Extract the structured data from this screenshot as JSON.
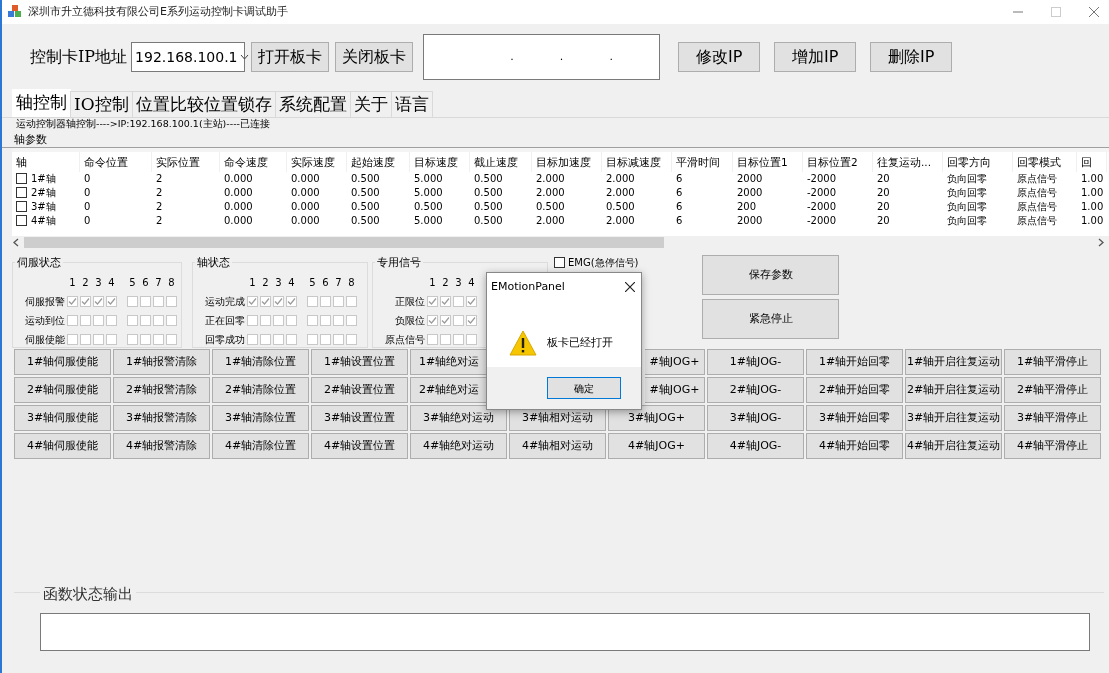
{
  "window": {
    "title": "深圳市升立德科技有限公司E系列运动控制卡调试助手"
  },
  "connection": {
    "label": "控制卡IP地址",
    "ip_value": "192.168.100.1",
    "buttons": [
      "打开板卡",
      "关闭板卡"
    ],
    "ip_separators": [
      ".",
      ".",
      "."
    ],
    "ip_buttons": [
      "修改IP",
      "增加IP",
      "删除IP"
    ]
  },
  "tabs": [
    {
      "label": "轴控制",
      "selected": true
    },
    {
      "label": "IO控制",
      "selected": false
    },
    {
      "label": "位置比较位置锁存",
      "selected": false
    },
    {
      "label": "系统配置",
      "selected": false
    },
    {
      "label": "关于",
      "selected": false
    },
    {
      "label": "语言",
      "selected": false
    }
  ],
  "status_text": "运动控制器轴控制---->IP:192.168.100.1(主站)----已连接",
  "axis_params": {
    "title": "轴参数",
    "columns": [
      "轴",
      "命令位置",
      "实际位置",
      "命令速度",
      "实际速度",
      "起始速度",
      "目标速度",
      "截止速度",
      "目标加速度",
      "目标减速度",
      "平滑时间",
      "目标位置1",
      "目标位置2",
      "往复运动...",
      "回零方向",
      "回零模式",
      "回"
    ],
    "rows": [
      {
        "checked": false,
        "cells": [
          "1#轴",
          "0",
          "2",
          "0.000",
          "0.000",
          "0.500",
          "5.000",
          "0.500",
          "2.000",
          "2.000",
          "6",
          "2000",
          "-2000",
          "20",
          "负向回零",
          "原点信号",
          "1.00"
        ]
      },
      {
        "checked": false,
        "cells": [
          "2#轴",
          "0",
          "2",
          "0.000",
          "0.000",
          "0.500",
          "5.000",
          "0.500",
          "2.000",
          "2.000",
          "6",
          "2000",
          "-2000",
          "20",
          "负向回零",
          "原点信号",
          "1.00"
        ]
      },
      {
        "checked": false,
        "cells": [
          "3#轴",
          "0",
          "2",
          "0.000",
          "0.000",
          "0.500",
          "0.500",
          "0.500",
          "0.500",
          "0.500",
          "6",
          "200",
          "-2000",
          "20",
          "负向回零",
          "原点信号",
          "1.00"
        ]
      },
      {
        "checked": false,
        "cells": [
          "4#轴",
          "0",
          "2",
          "0.000",
          "0.000",
          "0.500",
          "5.000",
          "0.500",
          "2.000",
          "2.000",
          "6",
          "2000",
          "-2000",
          "20",
          "负向回零",
          "原点信号",
          "1.00"
        ]
      }
    ]
  },
  "status_groups": [
    {
      "title": "伺服状态",
      "columns": [
        "1",
        "2",
        "3",
        "4",
        "5",
        "6",
        "7",
        "8"
      ],
      "rows": [
        {
          "label": "伺服报警",
          "bits": [
            true,
            true,
            true,
            true,
            false,
            false,
            false,
            false
          ]
        },
        {
          "label": "运动到位",
          "bits": [
            false,
            false,
            false,
            false,
            false,
            false,
            false,
            false
          ]
        },
        {
          "label": "伺服使能",
          "bits": [
            false,
            false,
            false,
            false,
            false,
            false,
            false,
            false
          ]
        }
      ]
    },
    {
      "title": "轴状态",
      "columns": [
        "1",
        "2",
        "3",
        "4",
        "5",
        "6",
        "7",
        "8"
      ],
      "rows": [
        {
          "label": "运动完成",
          "bits": [
            true,
            true,
            true,
            true,
            false,
            false,
            false,
            false
          ]
        },
        {
          "label": "正在回零",
          "bits": [
            false,
            false,
            false,
            false,
            false,
            false,
            false,
            false
          ]
        },
        {
          "label": "回零成功",
          "bits": [
            false,
            false,
            false,
            false,
            false,
            false,
            false,
            false
          ]
        }
      ]
    },
    {
      "title": "专用信号",
      "columns": [
        "1",
        "2",
        "3",
        "4"
      ],
      "rows": [
        {
          "label": "正限位",
          "bits": [
            true,
            true,
            false,
            true
          ]
        },
        {
          "label": "负限位",
          "bits": [
            true,
            true,
            false,
            true
          ]
        },
        {
          "label": "原点信号",
          "bits": [
            false,
            false,
            false,
            false
          ]
        }
      ]
    }
  ],
  "emg": {
    "label": "EMG(急停信号)",
    "checked": false
  },
  "side_buttons": [
    "保存参数",
    "紧急停止"
  ],
  "axis_buttons": [
    [
      {
        "label": "1#轴伺服使能",
        "kind": "full"
      },
      {
        "label": "1#轴报警清除",
        "kind": "full"
      },
      {
        "label": "1#轴清除位置",
        "kind": "full"
      },
      {
        "label": "1#轴设置位置",
        "kind": "full"
      },
      {
        "label": "1#轴绝对运",
        "kind": "cut_right"
      },
      {
        "kind": "covered"
      },
      {
        "label": "#轴JOG+",
        "kind": "cut_left"
      },
      {
        "label": "1#轴JOG-",
        "kind": "full"
      },
      {
        "label": "1#轴开始回零",
        "kind": "full"
      },
      {
        "label": "1#轴开启往复运动",
        "kind": "full"
      },
      {
        "label": "1#轴平滑停止",
        "kind": "full"
      }
    ],
    [
      {
        "label": "2#轴伺服使能",
        "kind": "full"
      },
      {
        "label": "2#轴报警清除",
        "kind": "full"
      },
      {
        "label": "2#轴清除位置",
        "kind": "full"
      },
      {
        "label": "2#轴设置位置",
        "kind": "full"
      },
      {
        "label": "2#轴绝对运",
        "kind": "cut_right"
      },
      {
        "kind": "covered"
      },
      {
        "label": "#轴JOG+",
        "kind": "cut_left"
      },
      {
        "label": "2#轴JOG-",
        "kind": "full"
      },
      {
        "label": "2#轴开始回零",
        "kind": "full"
      },
      {
        "label": "2#轴开启往复运动",
        "kind": "full"
      },
      {
        "label": "2#轴平滑停止",
        "kind": "full"
      }
    ],
    [
      {
        "label": "3#轴伺服使能",
        "kind": "full"
      },
      {
        "label": "3#轴报警清除",
        "kind": "full"
      },
      {
        "label": "3#轴清除位置",
        "kind": "full"
      },
      {
        "label": "3#轴设置位置",
        "kind": "full"
      },
      {
        "label": "3#轴绝对运动",
        "kind": "full"
      },
      {
        "label": "3#轴相对运动",
        "kind": "full"
      },
      {
        "label": "3#轴JOG+",
        "kind": "full"
      },
      {
        "label": "3#轴JOG-",
        "kind": "full"
      },
      {
        "label": "3#轴开始回零",
        "kind": "full"
      },
      {
        "label": "3#轴开启往复运动",
        "kind": "full"
      },
      {
        "label": "3#轴平滑停止",
        "kind": "full"
      }
    ],
    [
      {
        "label": "4#轴伺服使能",
        "kind": "full"
      },
      {
        "label": "4#轴报警清除",
        "kind": "full"
      },
      {
        "label": "4#轴清除位置",
        "kind": "full"
      },
      {
        "label": "4#轴设置位置",
        "kind": "full"
      },
      {
        "label": "4#轴绝对运动",
        "kind": "full"
      },
      {
        "label": "4#轴相对运动",
        "kind": "full"
      },
      {
        "label": "4#轴JOG+",
        "kind": "full"
      },
      {
        "label": "4#轴JOG-",
        "kind": "full"
      },
      {
        "label": "4#轴开始回零",
        "kind": "full"
      },
      {
        "label": "4#轴开启往复运动",
        "kind": "full"
      },
      {
        "label": "4#轴平滑停止",
        "kind": "full"
      }
    ]
  ],
  "dialog": {
    "title": "EMotionPanel",
    "message": "板卡已经打开",
    "button": "确定"
  },
  "output": {
    "title": "函数状态输出"
  }
}
